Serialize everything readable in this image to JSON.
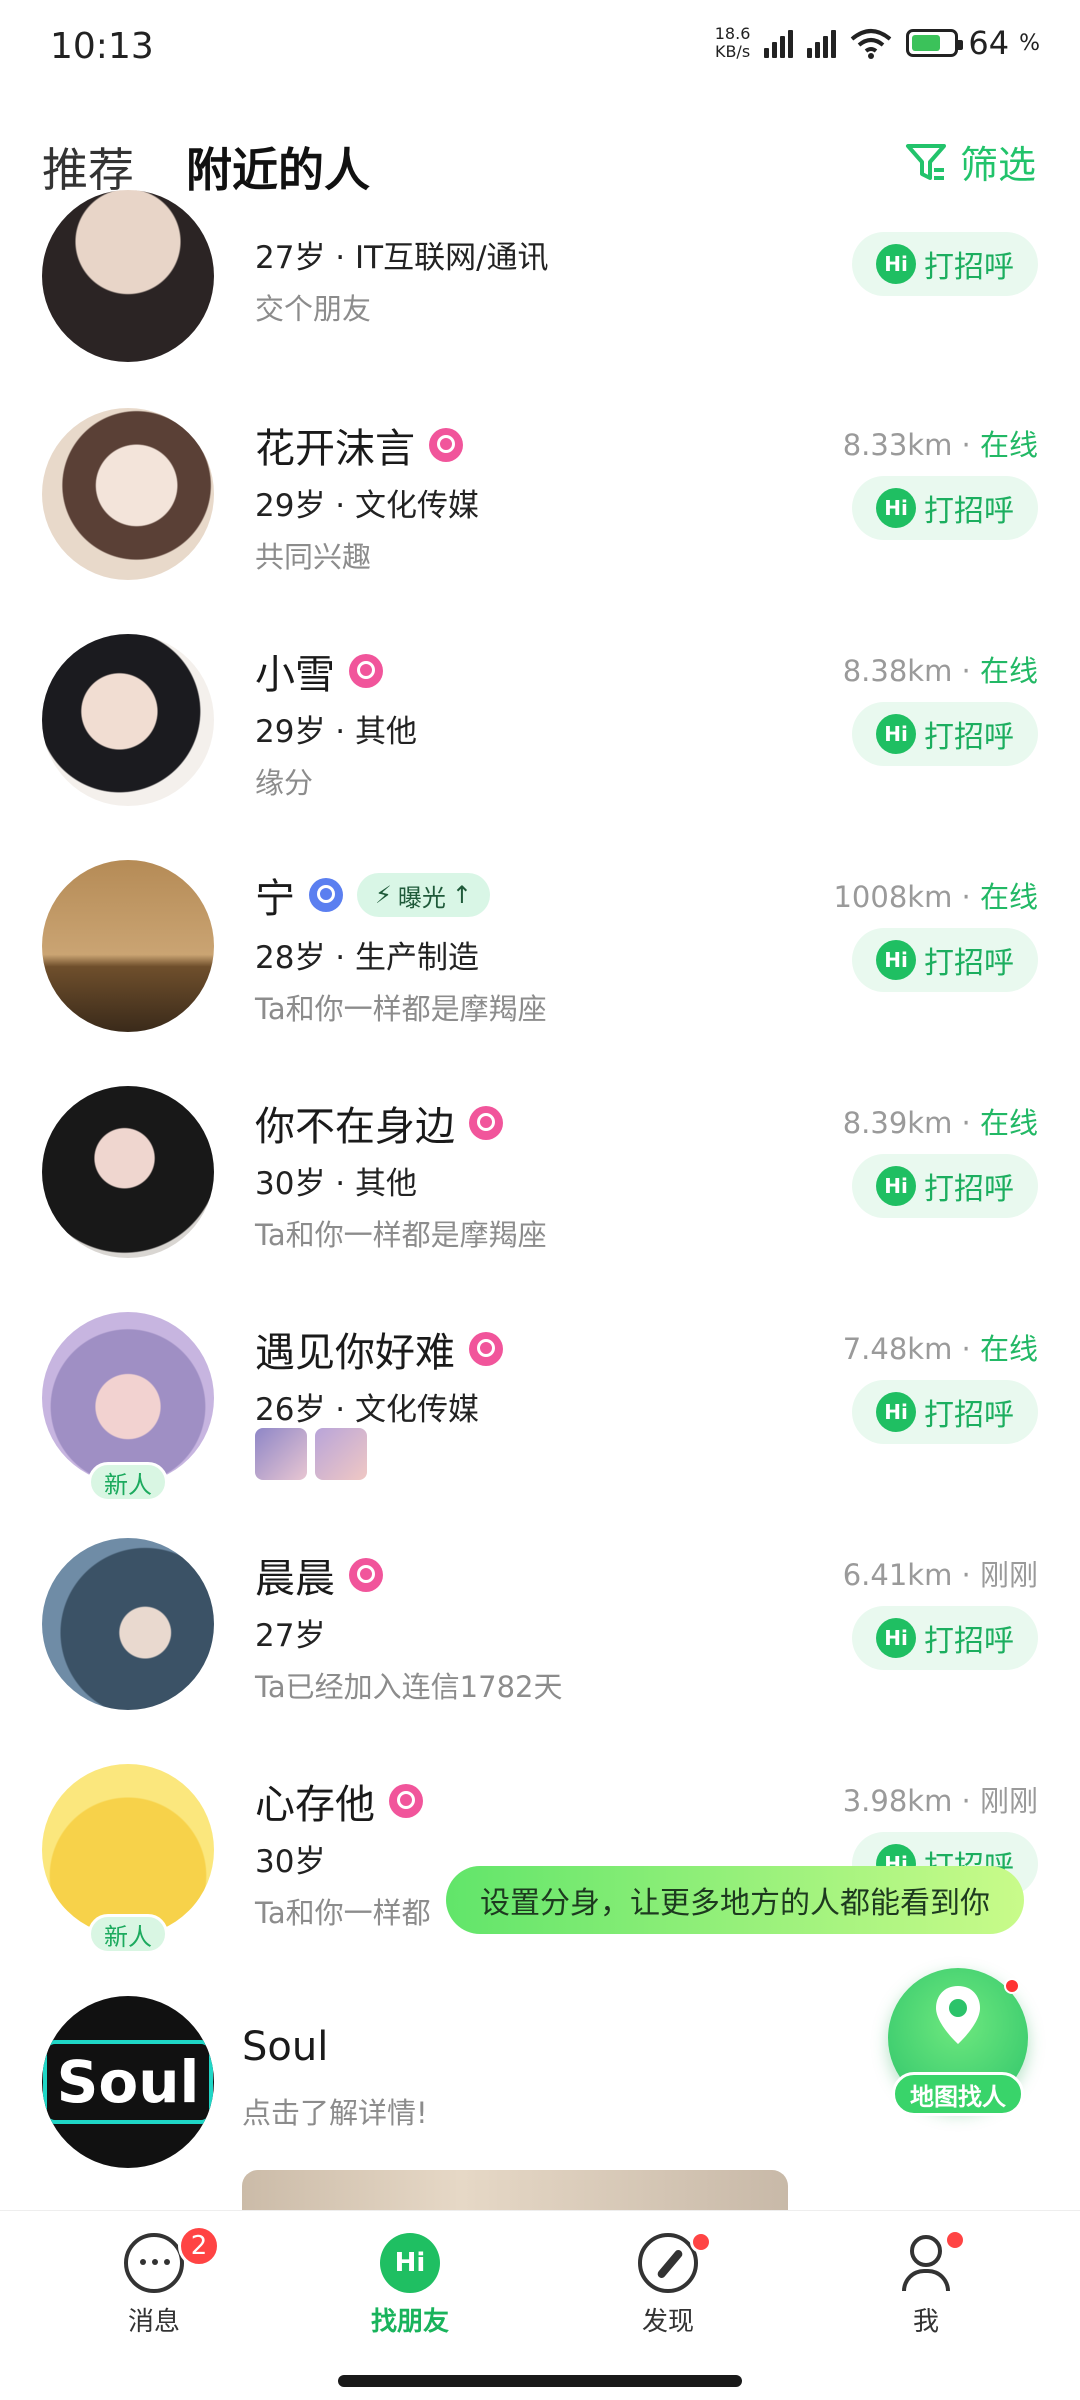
{
  "status": {
    "time": "10:13",
    "netspeed_top": "18.6",
    "netspeed_unit": "KB/s",
    "battery": "64"
  },
  "header": {
    "tab_recommend": "推荐",
    "tab_nearby": "附近的人",
    "filter_label": "筛选"
  },
  "users": [
    {
      "name": "",
      "info": "27岁 · IT互联网/通讯",
      "sub": "交个朋友",
      "distance": "",
      "status": "",
      "hi": "打招呼"
    },
    {
      "name": "花开沫言",
      "gender": "female",
      "info": "29岁 · 文化传媒",
      "sub": "共同兴趣",
      "distance": "8.33km",
      "status": "在线",
      "hi": "打招呼"
    },
    {
      "name": "小雪",
      "gender": "female",
      "info": "29岁 · 其他",
      "sub": "缘分",
      "distance": "8.38km",
      "status": "在线",
      "hi": "打招呼"
    },
    {
      "name": "宁",
      "gender": "male",
      "exposure": "曝光",
      "info": "28岁 · 生产制造",
      "sub": "Ta和你一样都是摩羯座",
      "distance": "1008km",
      "status": "在线",
      "hi": "打招呼"
    },
    {
      "name": "你不在身边",
      "gender": "female",
      "info": "30岁 · 其他",
      "sub": "Ta和你一样都是摩羯座",
      "distance": "8.39km",
      "status": "在线",
      "hi": "打招呼"
    },
    {
      "name": "遇见你好难",
      "gender": "female",
      "info": "26岁 · 文化传媒",
      "sub": "",
      "distance": "7.48km",
      "status": "在线",
      "hi": "打招呼",
      "badge": "新人"
    },
    {
      "name": "晨晨",
      "gender": "female",
      "info": "27岁",
      "sub": "Ta已经加入连信1782天",
      "distance": "6.41km",
      "status": "刚刚",
      "hi": "打招呼"
    },
    {
      "name": "心存他",
      "gender": "female",
      "info": "30岁",
      "sub": "Ta和你一样都",
      "distance": "3.98km",
      "status": "刚刚",
      "hi": "打招呼",
      "badge": "新人"
    }
  ],
  "ad": {
    "title": "Soul",
    "subtitle": "点击了解详情!",
    "logo": "Soul"
  },
  "tooltip": "设置分身，让更多地方的人都能看到你",
  "map_button": "地图找人",
  "nav": {
    "messages": "消息",
    "messages_badge": "2",
    "find": "找朋友",
    "discover": "发现",
    "me": "我"
  },
  "colors": {
    "accent": "#22c36b",
    "female": "#f1559b",
    "male": "#5b7ff0"
  }
}
